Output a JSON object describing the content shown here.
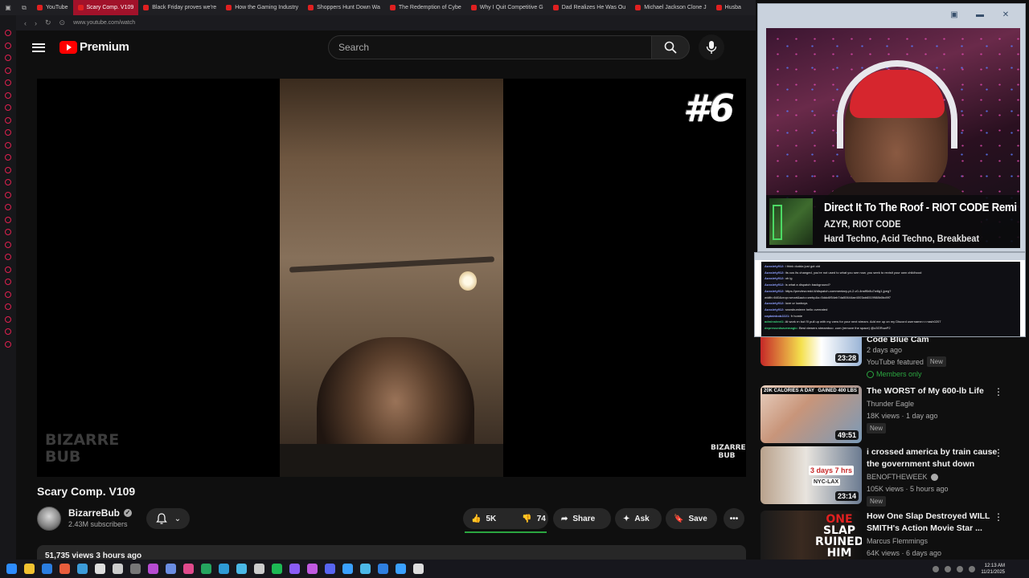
{
  "browser": {
    "tabs": [
      {
        "label": "YouTube",
        "active": false
      },
      {
        "label": "Scary Comp. V109",
        "active": true
      },
      {
        "label": "Black Friday proves we're",
        "active": false
      },
      {
        "label": "How the Gaming Industry",
        "active": false
      },
      {
        "label": "Shoppers Hunt Down Wa",
        "active": false
      },
      {
        "label": "The Redemption of Cybe",
        "active": false
      },
      {
        "label": "Why I Quit Competitive G",
        "active": false
      },
      {
        "label": "Dad Realizes He Was Ou",
        "active": false
      },
      {
        "label": "Michael Jackson Clone J",
        "active": false
      },
      {
        "label": "Husba",
        "active": false
      }
    ],
    "url": "www.youtube.com/watch"
  },
  "header": {
    "brand": "Premium",
    "search_placeholder": "Search"
  },
  "video": {
    "overlay_number": "#6",
    "watermark_left_1": "BIZARRE",
    "watermark_left_2": "BUB",
    "watermark_right_1": "BIZARRE",
    "watermark_right_2": "BUB",
    "title": "Scary Comp. V109",
    "channel": "BizarreBub",
    "subscribers": "2.43M subscribers",
    "likes": "5K",
    "dislikes": "74",
    "like_ratio": 0.985,
    "share_label": "Share",
    "ask_label": "Ask",
    "save_label": "Save",
    "views_line": "51,735 views  3 hours ago"
  },
  "stream_overlay": {
    "now_playing_title": "Direct It To The Roof - RIOT CODE Remi",
    "now_playing_artist": "AZYR, RIOT CODE",
    "now_playing_genre": "Hard Techno, Acid Techno, Breakbeat"
  },
  "chat": {
    "messages": [
      {
        "user": "Aussiety912:",
        "text": "i think dudda just got old"
      },
      {
        "user": "Aussiety912:",
        "text": "its cus its changed, you're not used to what you see now, you seek to revisit your own childhood"
      },
      {
        "user": "Aussiety912:",
        "text": "oh ig"
      },
      {
        "user": "Aussiety912:",
        "text": "is what a dispatch background?"
      },
      {
        "user": "Aussiety912:",
        "text": "https://preview.redd.it/dispatch-commentary-pt-2-v0-4nsff6r8u7w8g1.jpeg?"
      },
      {
        "user": "",
        "text": "width=640&crop=smart&auto=webp&s=5ddc6f54eb7da50644ae4003ab6519988b0bd9f7"
      },
      {
        "user": "Aussiety912:",
        "text": "love ur lowboys"
      },
      {
        "user": "Aussiety912:",
        "text": "snowburnieee hello overrated"
      },
      {
        "user": "captainbob2221:",
        "text": "fr homie"
      },
      {
        "user": "adminstext1:",
        "text": "At work rn but I'll pull up with my crew for your next stream. Add me up on my Discord username>>>rash0207"
      },
      {
        "user": "depressedsavemagic:",
        "text": "Best viewers streamboo .com (remove the space) @o3GRuwP2"
      }
    ]
  },
  "recommendations": [
    {
      "title": "Code Blue Cam",
      "channel": "",
      "views": "2 days ago",
      "duration": "23:28",
      "featured": "YouTube featured",
      "badge": "New",
      "members": "Members only",
      "verified": true
    },
    {
      "title": "The WORST of My 600-lb Life",
      "channel": "Thunder Eagle",
      "views": "18K views · 1 day ago",
      "duration": "49:51",
      "badge": "New",
      "thumb_left": "20K CALORIES A DAY",
      "thumb_right": "GAINED 400 LBS",
      "verified": false
    },
    {
      "title": "i crossed america by train cause the government shut down",
      "channel": "BENOFTHEWEEK",
      "views": "105K views · 5 hours ago",
      "duration": "23:14",
      "badge": "New",
      "thumb_tag1": "3 days 7 hrs",
      "thumb_tag2": "NYC-LAX",
      "verified": true
    },
    {
      "title": "How One Slap Destroyed WILL SMITH's Action Movie Star ...",
      "channel": "Marcus Flemmings",
      "views": "64K views · 6 days ago",
      "thumb_text_1": "ONE",
      "thumb_text_2": "SLAP",
      "thumb_text_3": "RUINED",
      "thumb_text_4": "HIM",
      "verified": false
    }
  ],
  "taskbar": {
    "time": "12:13 AM",
    "date": "11/21/2025"
  },
  "colors": {
    "youtube_red": "#ff0000",
    "active_tab": "#a1122a",
    "like_bar": "#2ba640"
  }
}
